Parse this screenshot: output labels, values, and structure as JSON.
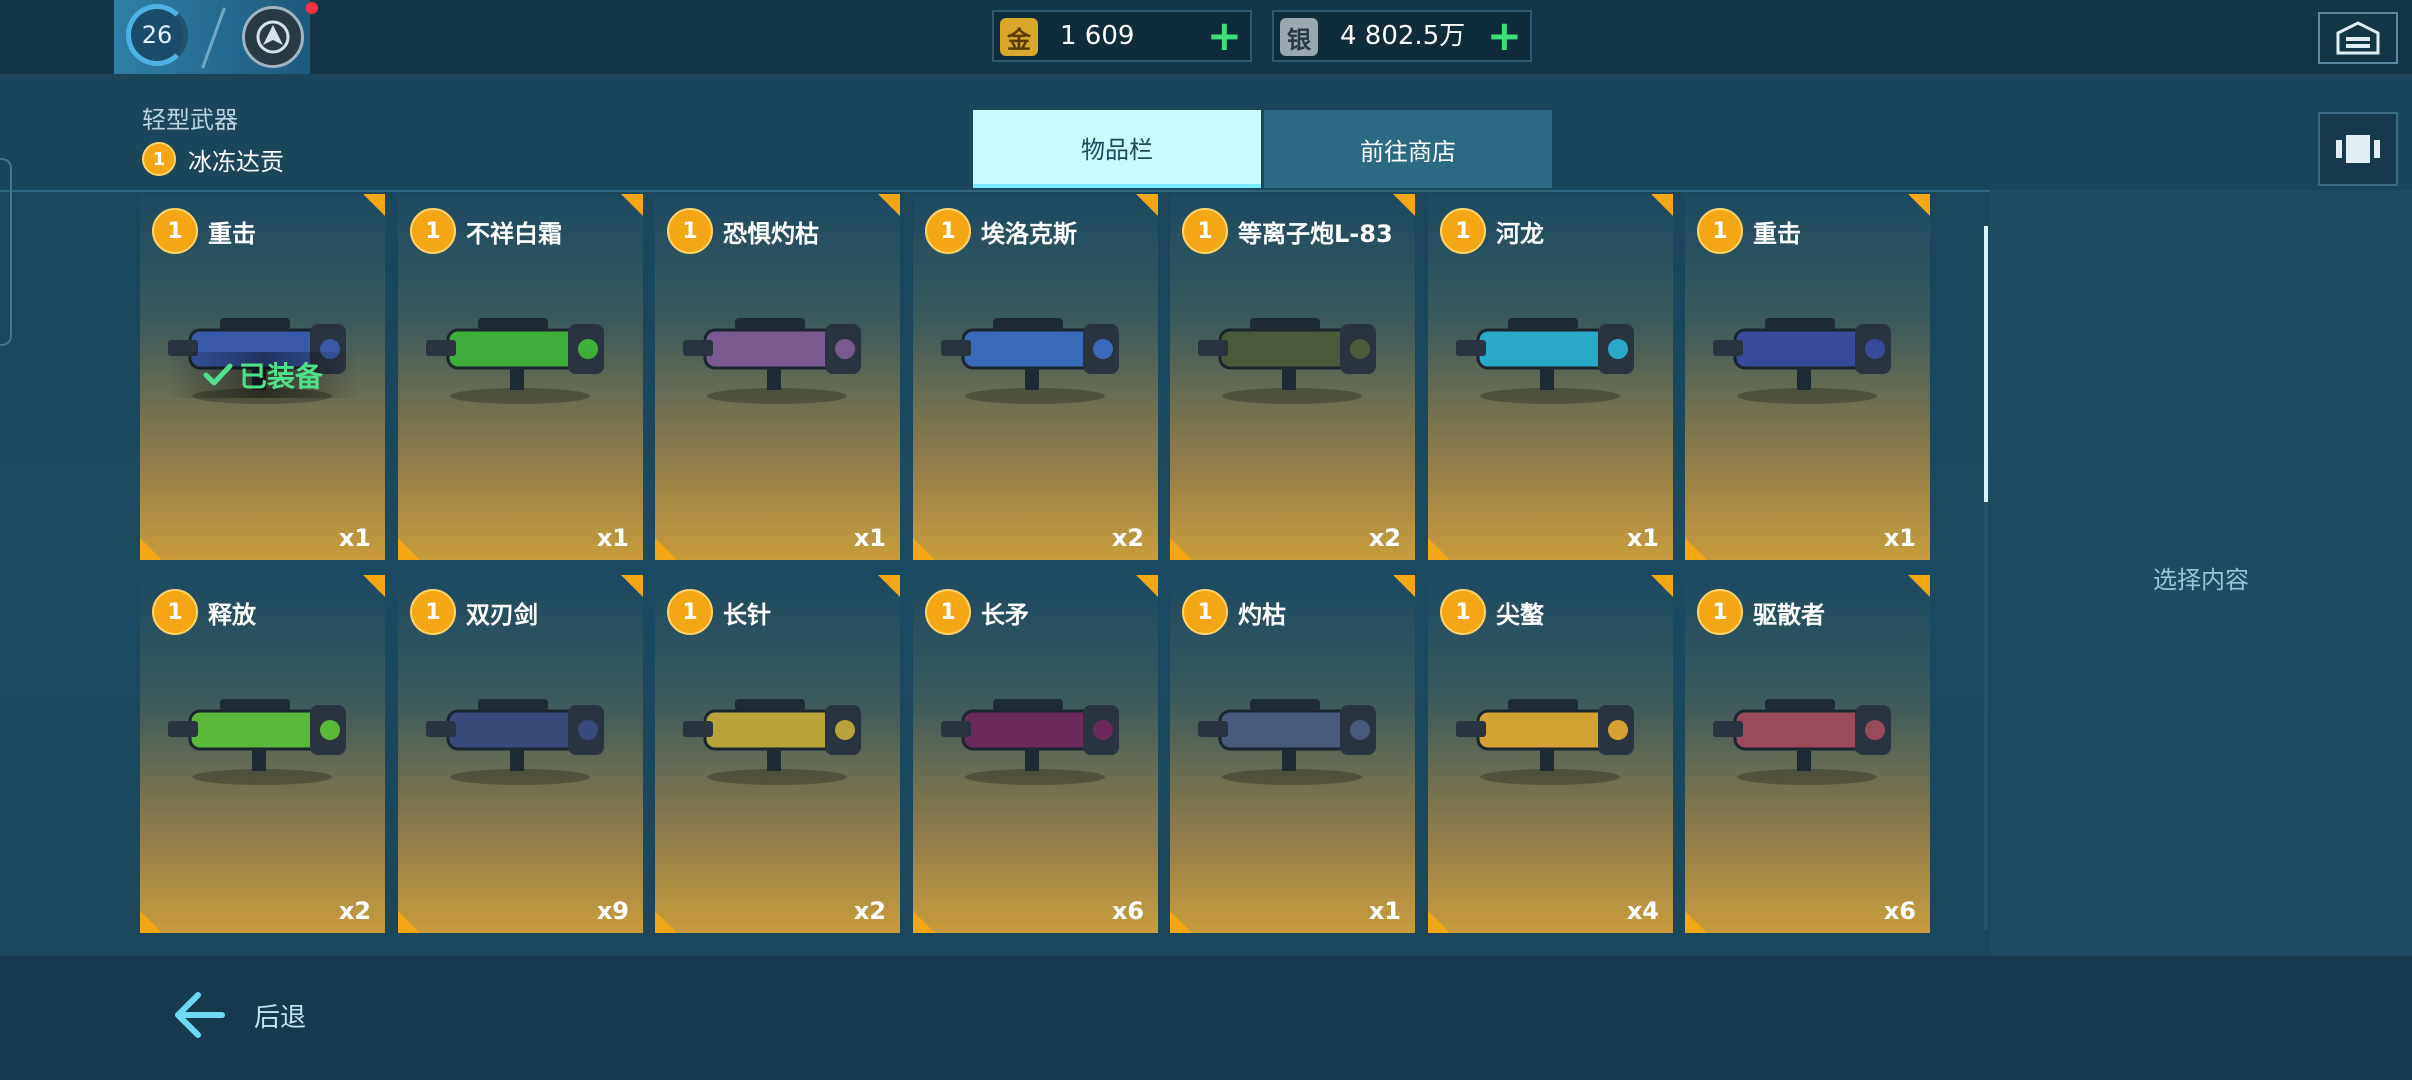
{
  "player": {
    "level": "26"
  },
  "currency": {
    "gold": {
      "icon_char": "金",
      "value": "1 609"
    },
    "silver": {
      "icon_char": "银",
      "value": "4 802.5万"
    }
  },
  "header": {
    "category": "轻型武器",
    "sub_level": "1",
    "sub_label": "冰冻达贡"
  },
  "tabs": [
    {
      "label": "物品栏",
      "active": true
    },
    {
      "label": "前往商店",
      "active": false
    }
  ],
  "items": [
    {
      "level": "1",
      "name": "重击",
      "qty": "x1",
      "equipped": true,
      "equipped_label": "已装备",
      "color": "#3a5aa8"
    },
    {
      "level": "1",
      "name": "不祥白霜",
      "qty": "x1",
      "equipped": false,
      "color": "#3fae3a"
    },
    {
      "level": "1",
      "name": "恐惧灼枯",
      "qty": "x1",
      "equipped": false,
      "color": "#7a5a8e"
    },
    {
      "level": "1",
      "name": "埃洛克斯",
      "qty": "x2",
      "equipped": false,
      "color": "#3a6ab8"
    },
    {
      "level": "1",
      "name": "等离子炮L-83",
      "qty": "x2",
      "equipped": false,
      "color": "#4a5a3a"
    },
    {
      "level": "1",
      "name": "河龙",
      "qty": "x1",
      "equipped": false,
      "color": "#2aa8c8"
    },
    {
      "level": "1",
      "name": "重击",
      "qty": "x1",
      "equipped": false,
      "color": "#3a4a9a"
    },
    {
      "level": "1",
      "name": "释放",
      "qty": "x2",
      "equipped": false,
      "color": "#5ab83a"
    },
    {
      "level": "1",
      "name": "双刃剑",
      "qty": "x9",
      "equipped": false,
      "color": "#3a4a7a"
    },
    {
      "level": "1",
      "name": "长针",
      "qty": "x2",
      "equipped": false,
      "color": "#b8a23a"
    },
    {
      "level": "1",
      "name": "长矛",
      "qty": "x6",
      "equipped": false,
      "color": "#6a2a5a"
    },
    {
      "level": "1",
      "name": "灼枯",
      "qty": "x1",
      "equipped": false,
      "color": "#4a5a7a"
    },
    {
      "level": "1",
      "name": "尖螯",
      "qty": "x4",
      "equipped": false,
      "color": "#d4a232"
    },
    {
      "level": "1",
      "name": "驱散者",
      "qty": "x6",
      "equipped": false,
      "color": "#9a4a5a"
    }
  ],
  "right_panel": {
    "placeholder": "选择内容"
  },
  "footer": {
    "back_label": "后退"
  }
}
